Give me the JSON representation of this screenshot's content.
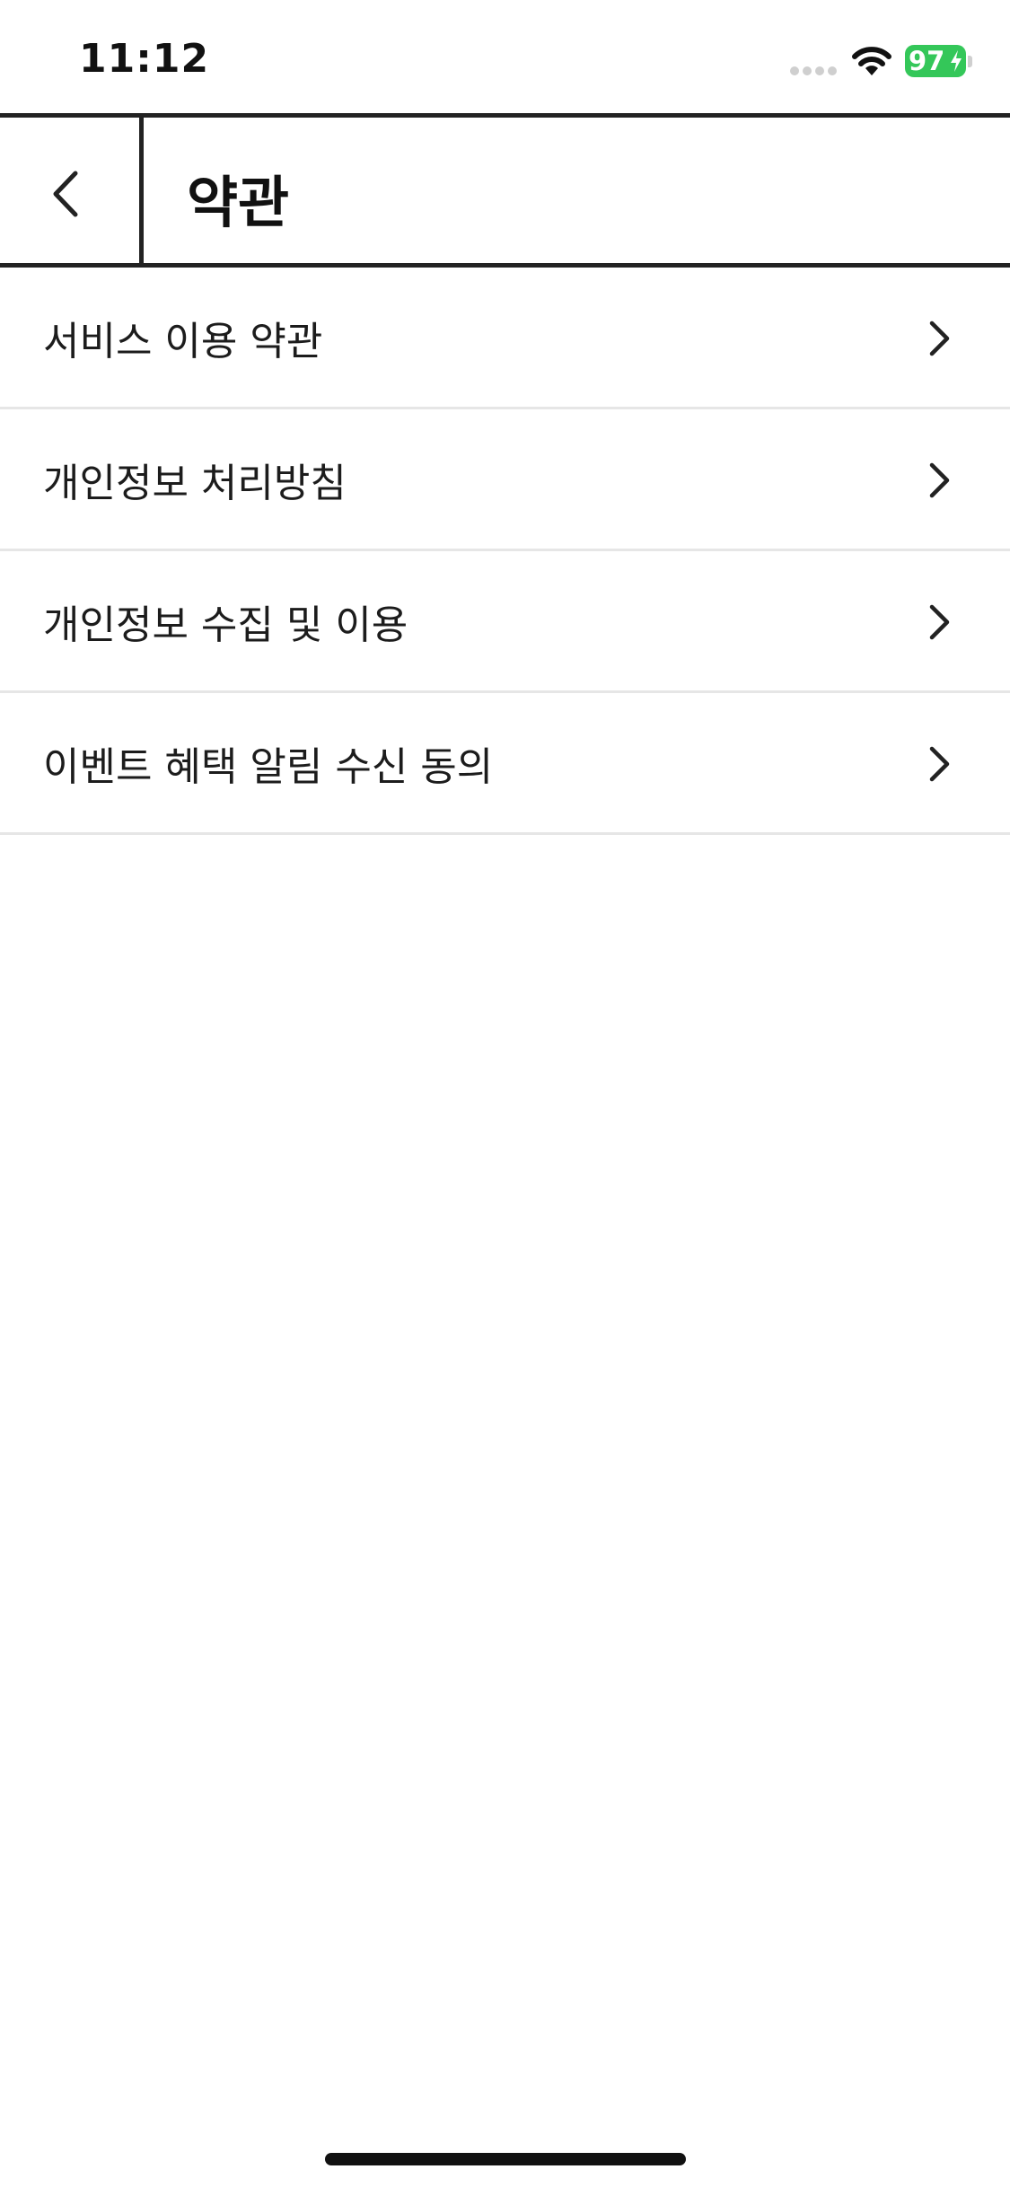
{
  "status_bar": {
    "time": "11:12",
    "battery_percent": "97",
    "icons": [
      "signal-icon",
      "wifi-icon",
      "battery-charging-icon"
    ],
    "battery_color": "#34c759"
  },
  "header": {
    "title": "약관",
    "back_icon": "chevron-left-icon"
  },
  "menu": {
    "items": [
      {
        "label": "서비스 이용 약관",
        "icon": "chevron-right-icon"
      },
      {
        "label": "개인정보 처리방침",
        "icon": "chevron-right-icon"
      },
      {
        "label": "개인정보 수집 및 이용",
        "icon": "chevron-right-icon"
      },
      {
        "label": "이벤트 혜택 알림 수신 동의",
        "icon": "chevron-right-icon"
      }
    ]
  },
  "colors": {
    "border": "#222222",
    "divider": "#e6e6e6",
    "text": "#1c1c1c"
  }
}
